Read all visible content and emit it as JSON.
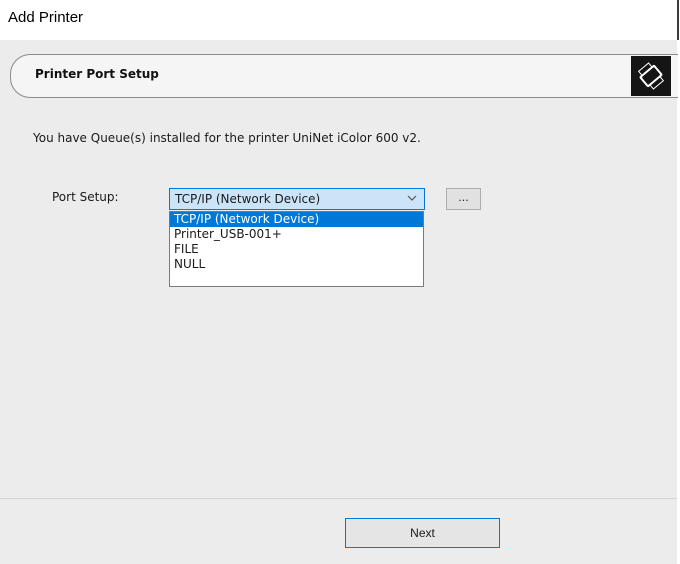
{
  "window": {
    "title": "Add Printer"
  },
  "header": {
    "title": "Printer Port Setup",
    "icon": "printer-icon"
  },
  "main": {
    "info": "You have Queue(s) installed for the printer UniNet iColor 600 v2.",
    "port_label": "Port Setup:",
    "port_select": {
      "value": "TCP/IP (Network Device)",
      "options": [
        "TCP/IP (Network Device)",
        "Printer_USB-001+",
        "FILE",
        "NULL"
      ],
      "selected_index": 0
    },
    "browse_label": "..."
  },
  "footer": {
    "next_label": "Next"
  },
  "colors": {
    "accent": "#0078d7",
    "select_bg": "#cce4f7",
    "panel_bg": "#ececec"
  }
}
